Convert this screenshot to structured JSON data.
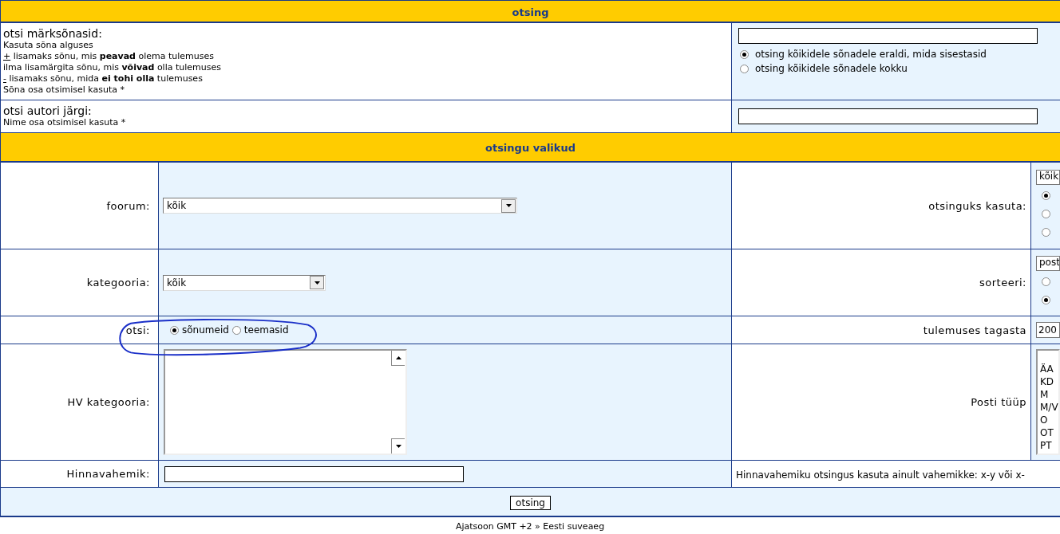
{
  "header": {
    "title": "otsing"
  },
  "keywords": {
    "label": "otsi märksõnasid:",
    "hints": [
      {
        "text": "Kasuta sõna alguses"
      },
      {
        "sign": "+",
        "text": "lisamaks sõnu, mis **peavad** olema tulemuses"
      },
      {
        "text": "ilma lisamärgita sõnu, mis **võivad** olla tulemuses"
      },
      {
        "sign": "-",
        "text": "lisamaks sõnu, mida **ei tohi olla** tulemuses"
      },
      {
        "text": "Sõna osa otsimisel kasuta *"
      }
    ],
    "modes": [
      {
        "label": "otsing kõikidele sõnadele eraldi, mida sisestasid",
        "selected": true
      },
      {
        "label": "otsing kõikidele sõnadele kokku",
        "selected": false
      }
    ]
  },
  "author": {
    "label": "otsi autori järgi:",
    "hint": "Nime osa otsimisel kasuta *"
  },
  "options_header": {
    "title": "otsingu valikud"
  },
  "rows": [
    {
      "left": {
        "label": "foorum:",
        "kind": "select",
        "value": "kõik"
      },
      "right": {
        "label": "otsinguks kasuta:",
        "kind": "select_radios",
        "value": "kõik",
        "options": [
          {
            "selected": true
          },
          {
            "selected": false
          },
          {
            "selected": false
          }
        ]
      }
    },
    {
      "left": {
        "label": "kategooria:",
        "kind": "select",
        "value": "kõik"
      },
      "right": {
        "label": "sorteeri:",
        "kind": "select_radios",
        "value": "post",
        "options": [
          {
            "selected": false
          },
          {
            "selected": true
          }
        ]
      }
    },
    {
      "left": {
        "label": "otsi:",
        "kind": "radios",
        "options": [
          {
            "label": "sõnumeid",
            "selected": true
          },
          {
            "label": "teemasid",
            "selected": false
          }
        ]
      },
      "right": {
        "label": "tulemuses tagasta",
        "kind": "text",
        "value": "200"
      }
    },
    {
      "left": {
        "label": "HV kategooria:",
        "kind": "listbox"
      },
      "right": {
        "label": "Posti tüüp",
        "kind": "listbox",
        "items": [
          "ÄA",
          "KD",
          "M",
          "M/V",
          "O",
          "OT",
          "PT"
        ]
      }
    },
    {
      "left": {
        "label": "Hinnavahemik:",
        "kind": "text"
      },
      "right": {
        "kind": "note",
        "text": "Hinnavahemiku otsingus kasuta ainult vahemikke: x-y või x-"
      }
    }
  ],
  "submit": "otsing",
  "footer": "Ajatsoon GMT +2 » Eesti suveaeg"
}
